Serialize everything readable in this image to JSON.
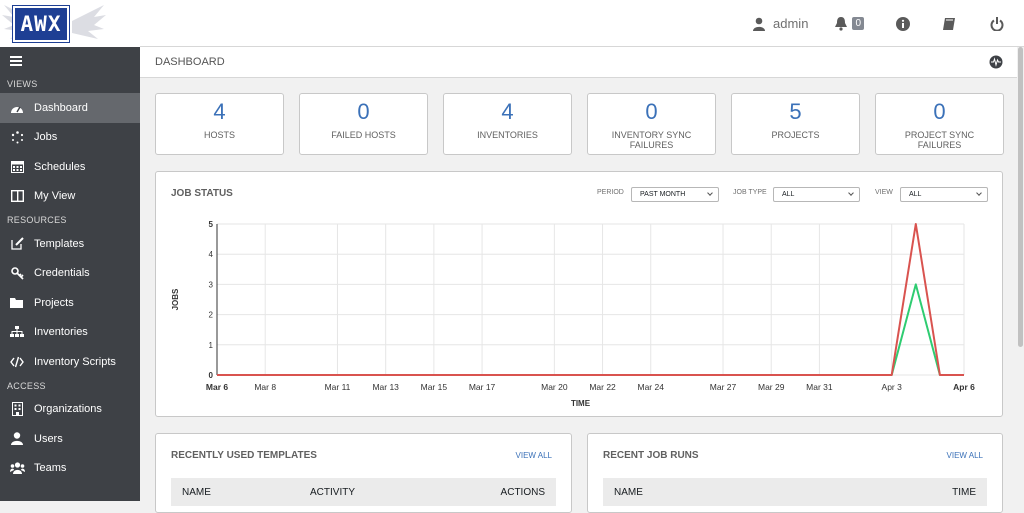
{
  "app": {
    "logo_text": "AWX",
    "user": "admin",
    "notification_count": "0"
  },
  "sidebar": {
    "sections": [
      {
        "title": "VIEWS",
        "items": [
          {
            "label": "Dashboard",
            "icon": "dashboard-icon",
            "active": true
          },
          {
            "label": "Jobs",
            "icon": "spinner-icon"
          },
          {
            "label": "Schedules",
            "icon": "calendar-icon"
          },
          {
            "label": "My View",
            "icon": "columns-icon"
          }
        ]
      },
      {
        "title": "RESOURCES",
        "items": [
          {
            "label": "Templates",
            "icon": "edit-icon"
          },
          {
            "label": "Credentials",
            "icon": "key-icon"
          },
          {
            "label": "Projects",
            "icon": "folder-icon"
          },
          {
            "label": "Inventories",
            "icon": "sitemap-icon"
          },
          {
            "label": "Inventory Scripts",
            "icon": "code-icon"
          }
        ]
      },
      {
        "title": "ACCESS",
        "items": [
          {
            "label": "Organizations",
            "icon": "building-icon"
          },
          {
            "label": "Users",
            "icon": "user-icon"
          },
          {
            "label": "Teams",
            "icon": "users-icon"
          }
        ]
      }
    ]
  },
  "breadcrumb": "DASHBOARD",
  "counts": [
    {
      "num": "4",
      "label": "HOSTS"
    },
    {
      "num": "0",
      "label": "FAILED HOSTS"
    },
    {
      "num": "4",
      "label": "INVENTORIES"
    },
    {
      "num": "0",
      "label": "INVENTORY SYNC FAILURES"
    },
    {
      "num": "5",
      "label": "PROJECTS"
    },
    {
      "num": "0",
      "label": "PROJECT SYNC FAILURES"
    }
  ],
  "job_status": {
    "title": "JOB STATUS",
    "period_label": "PERIOD",
    "period_value": "PAST MONTH",
    "job_type_label": "JOB TYPE",
    "job_type_value": "ALL",
    "view_label": "VIEW",
    "view_value": "ALL"
  },
  "chart_data": {
    "type": "line",
    "xlabel": "TIME",
    "ylabel": "JOBS",
    "ylim": [
      0,
      5
    ],
    "yticks": [
      "0",
      "1",
      "2",
      "3",
      "4",
      "5"
    ],
    "xticks": [
      "Mar 6",
      "Mar 8",
      "Mar 11",
      "Mar 13",
      "Mar 15",
      "Mar 17",
      "Mar 20",
      "Mar 22",
      "Mar 24",
      "Mar 27",
      "Mar 29",
      "Mar 31",
      "Apr 3",
      "Apr 6"
    ],
    "x": [
      "Mar 6",
      "Mar 7",
      "Mar 8",
      "Mar 9",
      "Mar 10",
      "Mar 11",
      "Mar 12",
      "Mar 13",
      "Mar 14",
      "Mar 15",
      "Mar 16",
      "Mar 17",
      "Mar 18",
      "Mar 19",
      "Mar 20",
      "Mar 21",
      "Mar 22",
      "Mar 23",
      "Mar 24",
      "Mar 25",
      "Mar 26",
      "Mar 27",
      "Mar 28",
      "Mar 29",
      "Mar 30",
      "Mar 31",
      "Apr 1",
      "Apr 2",
      "Apr 3",
      "Apr 4",
      "Apr 5",
      "Apr 6"
    ],
    "grid": true,
    "series": [
      {
        "color": "#d9534f",
        "values": [
          0,
          0,
          0,
          0,
          0,
          0,
          0,
          0,
          0,
          0,
          0,
          0,
          0,
          0,
          0,
          0,
          0,
          0,
          0,
          0,
          0,
          0,
          0,
          0,
          0,
          0,
          0,
          0,
          0,
          5,
          0,
          0
        ]
      },
      {
        "color": "#2ecc71",
        "values": [
          0,
          0,
          0,
          0,
          0,
          0,
          0,
          0,
          0,
          0,
          0,
          0,
          0,
          0,
          0,
          0,
          0,
          0,
          0,
          0,
          0,
          0,
          0,
          0,
          0,
          0,
          0,
          0,
          0,
          3,
          0,
          0
        ]
      }
    ]
  },
  "recent_templates": {
    "title": "RECENTLY USED TEMPLATES",
    "view_all": "VIEW ALL",
    "columns": [
      "NAME",
      "ACTIVITY",
      "ACTIONS"
    ]
  },
  "recent_jobs": {
    "title": "RECENT JOB RUNS",
    "view_all": "VIEW ALL",
    "columns": [
      "NAME",
      "TIME"
    ]
  }
}
